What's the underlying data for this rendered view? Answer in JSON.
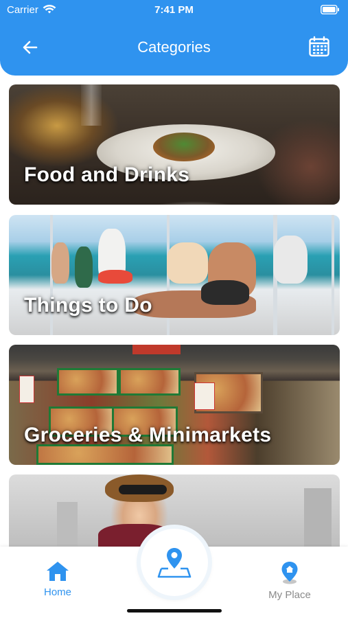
{
  "status_bar": {
    "carrier": "Carrier",
    "time": "7:41 PM"
  },
  "header": {
    "title": "Categories"
  },
  "icons": {
    "back": "arrow-left-icon",
    "calendar": "calendar-icon",
    "wifi": "wifi-icon",
    "battery": "battery-icon",
    "home": "home-icon",
    "map": "map-pin-icon",
    "place": "location-pin-icon"
  },
  "colors": {
    "accent": "#2f93ef",
    "tab_inactive": "#8a8a8a"
  },
  "categories": [
    {
      "label": "Food and Drinks"
    },
    {
      "label": "Things to Do"
    },
    {
      "label": "Groceries & Minimarkets"
    },
    {
      "label": ""
    }
  ],
  "tab_bar": {
    "home_label": "Home",
    "myplace_label": "My Place",
    "active": "Home"
  }
}
